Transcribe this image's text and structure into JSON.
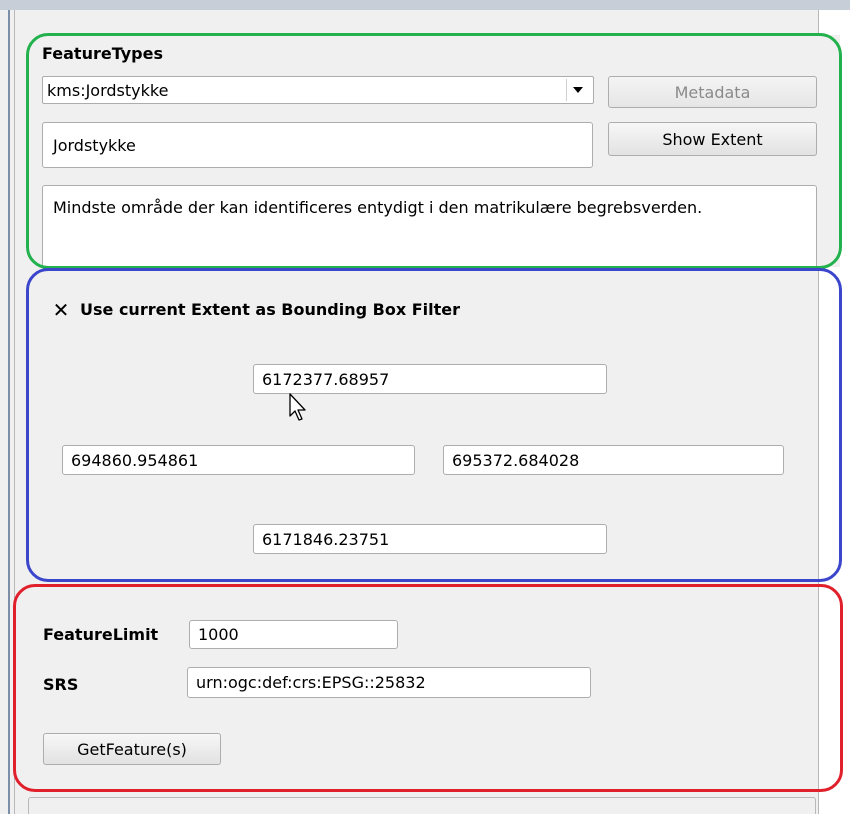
{
  "featuretypes": {
    "heading": "FeatureTypes",
    "selected_type": "kms:Jordstykke",
    "title_value": "Jordstykke",
    "abstract": "Mindste område der kan identificeres entydigt i den matrikulære begrebsverden.",
    "metadata_label": "Metadata",
    "show_extent_label": "Show Extent"
  },
  "bbox": {
    "checkbox_checked": true,
    "checkbox_label": "Use current Extent as Bounding Box Filter",
    "north": "6172377.68957",
    "west": "694860.954861",
    "east": "695372.684028",
    "south": "6171846.23751"
  },
  "request": {
    "feature_limit_label": "FeatureLimit",
    "feature_limit_value": "1000",
    "srs_label": "SRS",
    "srs_value": "urn:ogc:def:crs:EPSG::25832",
    "get_feature_label": "GetFeature(s)"
  },
  "colors": {
    "group1_outline": "#22b14c",
    "group2_outline": "#3b46cc",
    "group3_outline": "#e0202a"
  }
}
